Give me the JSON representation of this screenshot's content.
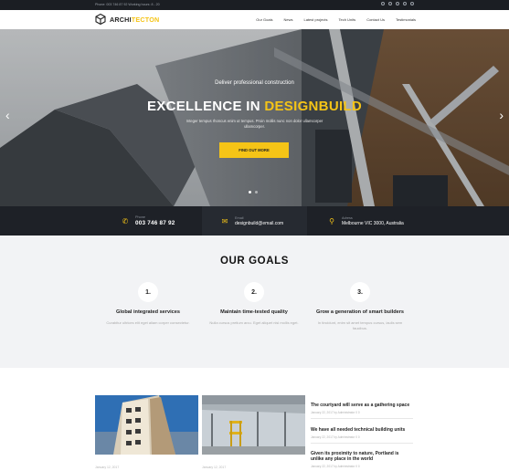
{
  "topbar": {
    "info": "Phone: 003 746 87 92 Working hours: 8 - 20"
  },
  "header": {
    "logo_a": "ARCHI",
    "logo_b": "TECTON",
    "nav": [
      "Our Goals",
      "News",
      "Latest projects",
      "Tech Units",
      "Contact Us",
      "Testimonials"
    ]
  },
  "hero": {
    "subtitle": "Deliver professional construction",
    "title_a": "EXCELLENCE IN ",
    "title_b": "DESIGNBUILD",
    "description": "Integer tempus rhoncus enim ut tempus. Proin mollis nunc non dolor ullamcorper ullamcorper.",
    "button": "FIND OUT MORE",
    "prev": "‹",
    "next": "›"
  },
  "contact": {
    "phone_label": "Phone",
    "phone_value": "003 746 87 92",
    "email_label": "Email",
    "email_value": "designbuild@email.com",
    "address_label": "Adress",
    "address_value": "Melbourne VIC 3000, Australia"
  },
  "goals": {
    "title": "OUR GOALS",
    "items": [
      {
        "num": "1.",
        "title": "Global integrated services",
        "desc": "Curabitur ultrices elit eget aliam corper consectetur."
      },
      {
        "num": "2.",
        "title": "Maintain time-tested quality",
        "desc": "Nulla cursus pretium arcu. Eget aliquet nisl mollis eget."
      },
      {
        "num": "3.",
        "title": "Grow a generation of smart builders",
        "desc": "In tincidunt, enim sit amet tempus cursus, iaulis sem faucibus."
      }
    ]
  },
  "news": {
    "cards": [
      {
        "meta": "January 12, 2017"
      },
      {
        "meta": "January 12, 2017"
      }
    ],
    "list": [
      {
        "title": "The courtyard will serve as a gathering space",
        "meta": "January 22, 2017  by Administrator   0   0"
      },
      {
        "title": "We have all needed technical building units",
        "meta": "January 22, 2017  by Administrator   0   0"
      },
      {
        "title": "Given its proximity to nature, Portland is unlike any place in the world",
        "meta": "January 22, 2017  by Administrator   0   0"
      }
    ]
  },
  "colors": {
    "accent": "#f5c417",
    "dark": "#1e2127",
    "light_bg": "#f2f3f5"
  }
}
